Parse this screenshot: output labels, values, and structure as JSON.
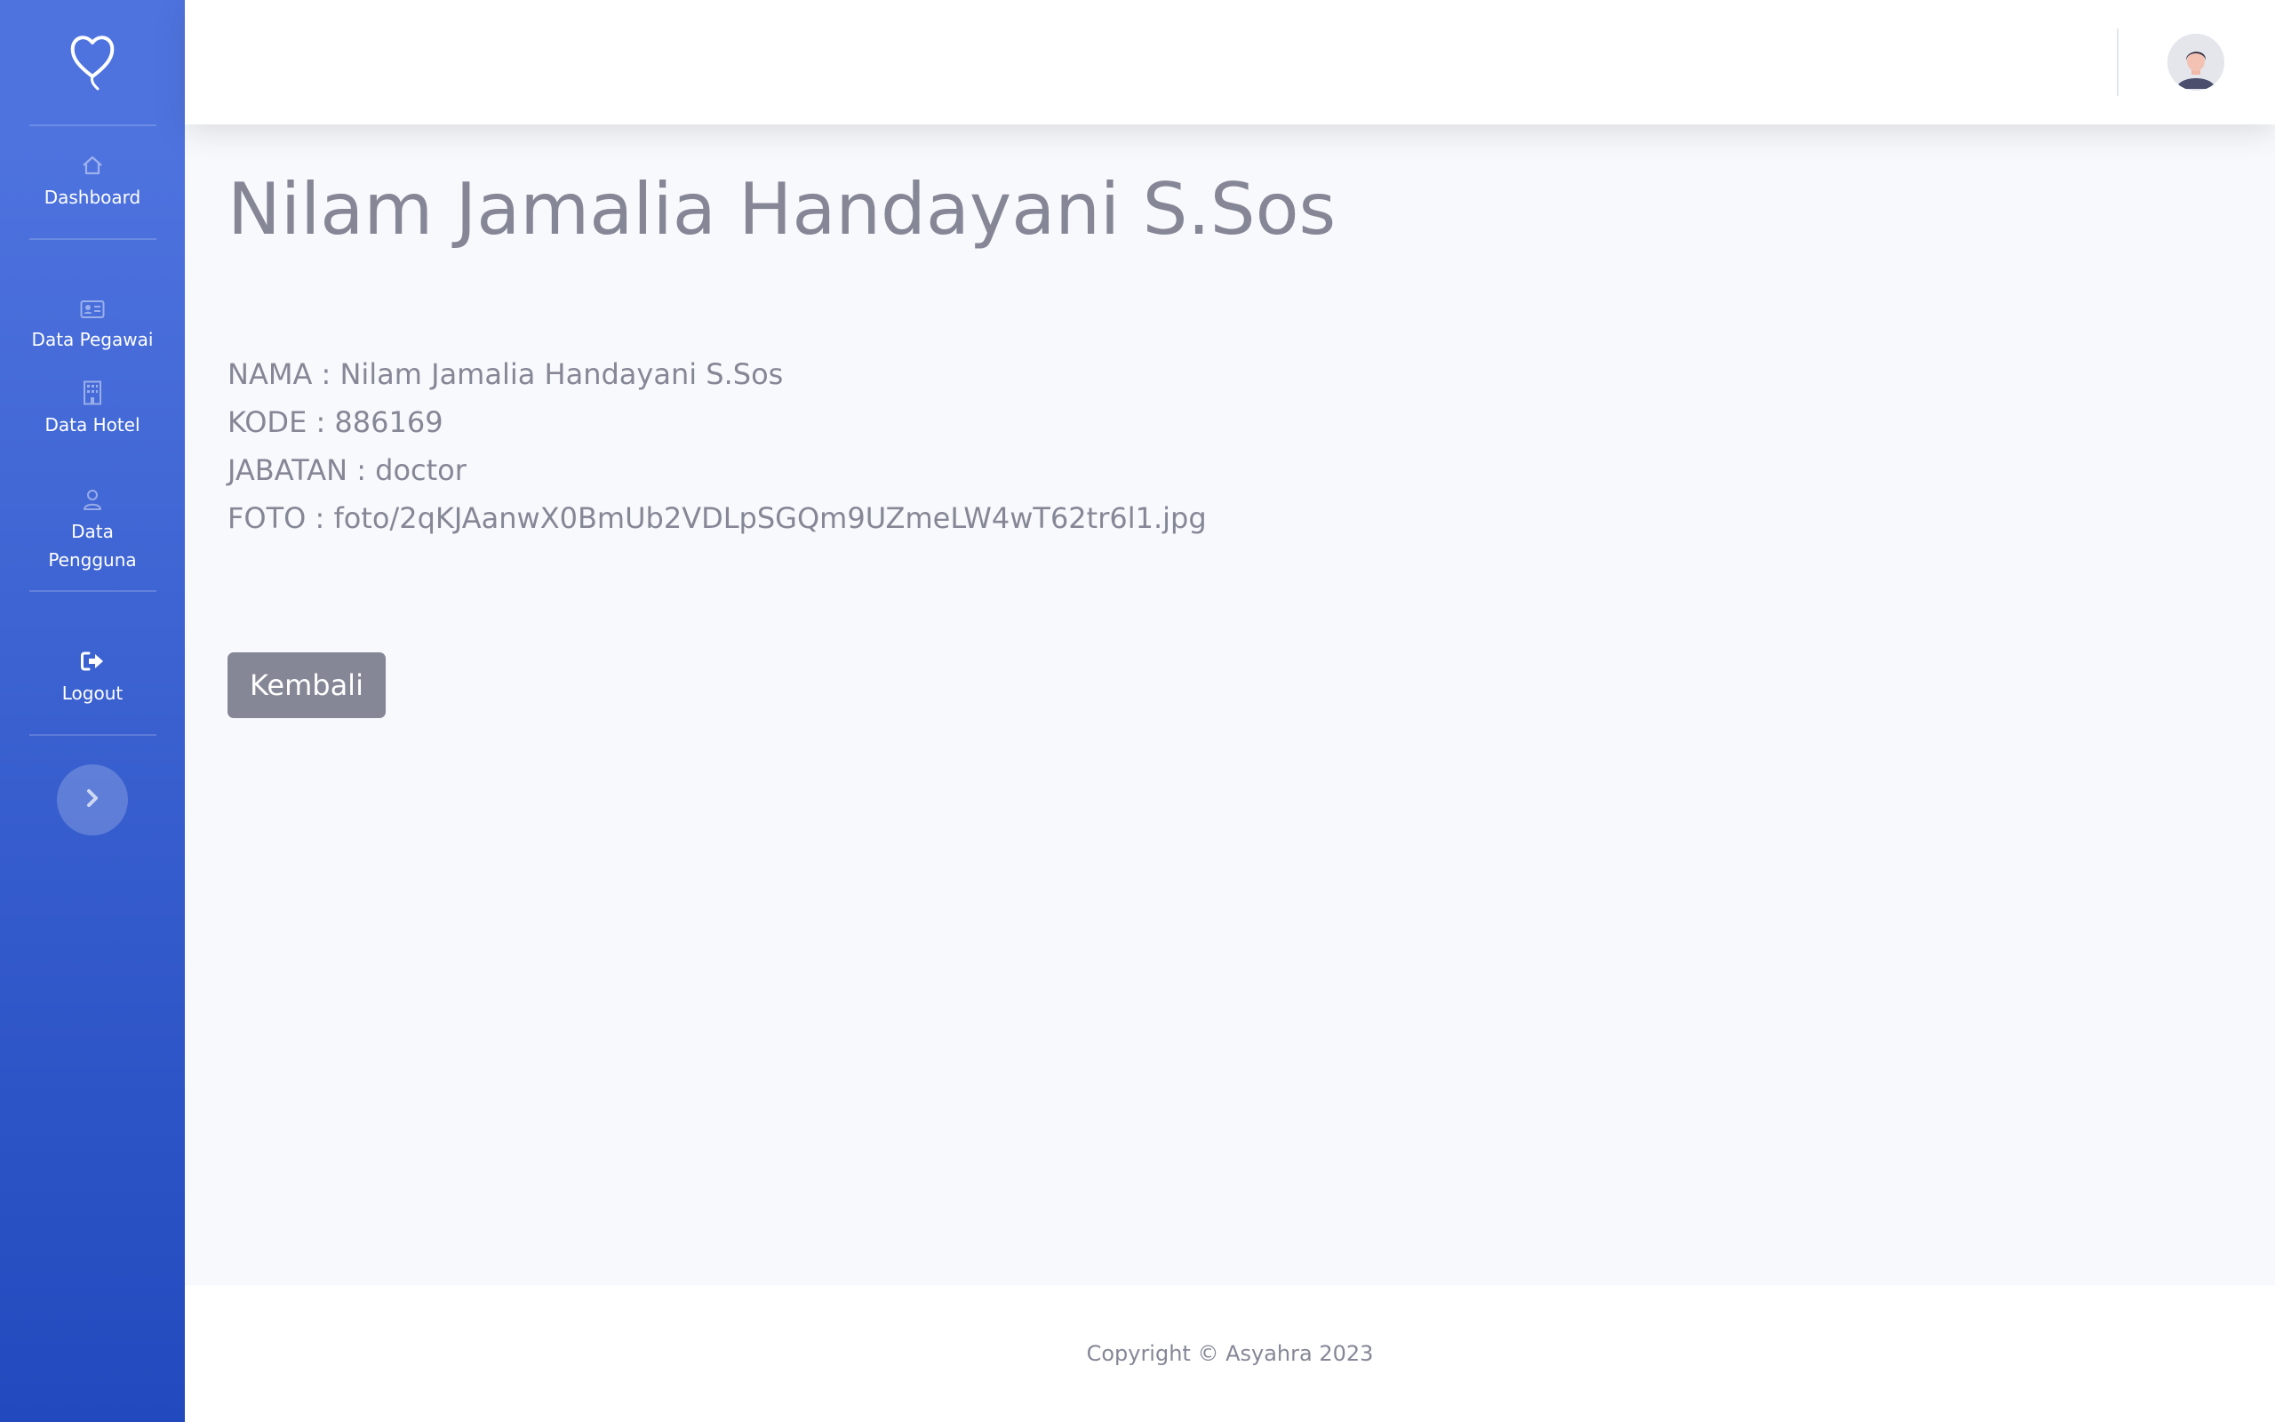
{
  "sidebar": {
    "brand_icon": "heart-balloon-icon",
    "items": [
      {
        "label": "Dashboard",
        "icon": "home-icon"
      },
      {
        "label": "Data Pegawai",
        "icon": "id-card-icon"
      },
      {
        "label": "Data Hotel",
        "icon": "building-icon"
      },
      {
        "label": "Data Pengguna",
        "icon": "user-icon"
      },
      {
        "label": "Logout",
        "icon": "sign-out-icon"
      }
    ],
    "toggle_icon": "chevron-right-icon"
  },
  "topbar": {
    "avatar_icon": "user-avatar-icon"
  },
  "main": {
    "title": "Nilam Jamalia Handayani S.Sos",
    "fields": {
      "nama": "NAMA : Nilam Jamalia Handayani S.Sos",
      "kode": "KODE : 886169",
      "jabatan": "JABATAN : doctor",
      "foto": "FOTO : foto/2qKJAanwX0BmUb2VDLpSGQm9UZmeLW4wT62tr6l1.jpg"
    },
    "back_button": "Kembali"
  },
  "footer": {
    "copyright": "Copyright © Asyahra 2023"
  },
  "colors": {
    "sidebar_top": "#4e73df",
    "sidebar_bottom": "#224abe",
    "text_gray": "#858796",
    "page_bg": "#f8f9fc"
  }
}
